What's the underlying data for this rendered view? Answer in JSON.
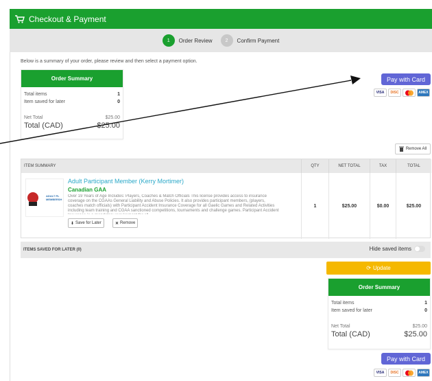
{
  "header": {
    "title": "Checkout & Payment"
  },
  "steps": [
    {
      "num": "1",
      "label": "Order Review"
    },
    {
      "num": "2",
      "label": "Confirm Payment"
    }
  ],
  "intro": "Below is a summary of your order, please review and then select a payment option.",
  "summary": {
    "title": "Order Summary",
    "total_items_label": "Total items",
    "total_items_value": "1",
    "saved_label": "Item saved for later",
    "saved_value": "0",
    "net_label": "Net Total",
    "net_value": "$25.00",
    "total_label": "Total (CAD)",
    "total_value": "$25.00"
  },
  "pay_button": "Pay with Card",
  "cards": [
    "VISA",
    "DISCOVER",
    "MC",
    "AMEX"
  ],
  "remove_all": "Remove All",
  "table": {
    "headers": {
      "item": "ITEM SUMMARY",
      "qty": "QTY",
      "net": "NET TOTAL",
      "tax": "TAX",
      "total": "TOTAL"
    },
    "row": {
      "thumb_text": "ADULT PL MEMBERSH",
      "title": "Adult Participant Member (Kerry Mortimer)",
      "org": "Canadian GAA",
      "description": "Over 19 Years of Age Includes: Players, Coaches & Match Officials This license provides access to insurance coverage on the CGAAs General Liability and Abuse Policies. It also provides participant members, (players, coaches match officials) with Participant Accident Insurance Coverage for all Gaelic Games and Related Activities including team training and CGAA sanctioned competitions, tournaments and challenge games. Participant Accident Insurance is a mandatory requirement for all",
      "save_later": "Save for Later",
      "remove": "Remove",
      "qty": "1",
      "net": "$25.00",
      "tax": "$0.00",
      "total": "$25.00"
    }
  },
  "saved_section": {
    "label": "ITEMS SAVED FOR LATER (0)",
    "hide_label": "Hide saved items"
  },
  "update_button": "Update",
  "colors": {
    "primary_green": "#1aa02f",
    "pay_purple": "#6166d6",
    "update_yellow": "#f5b800"
  }
}
